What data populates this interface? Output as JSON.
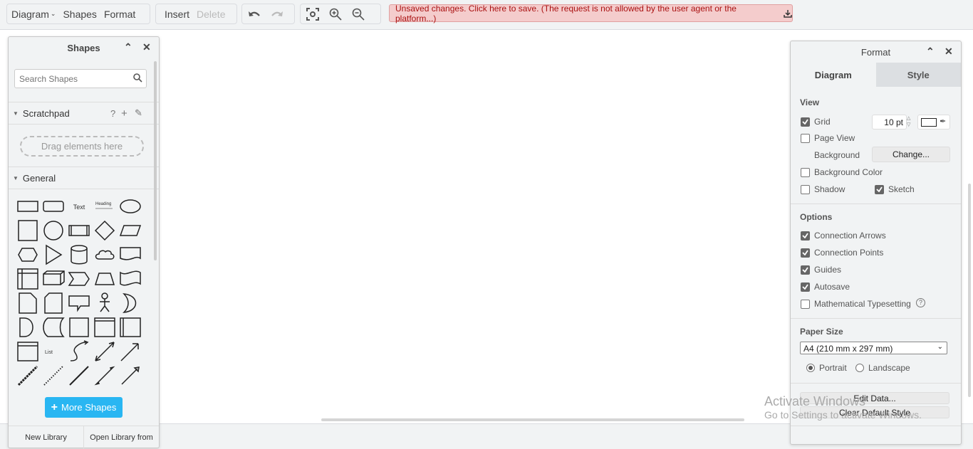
{
  "toolbar": {
    "diagram": "Diagram",
    "shapes": "Shapes",
    "format": "Format",
    "insert": "Insert",
    "delete": "Delete",
    "icons": [
      "undo-icon",
      "redo-icon",
      "fit-icon",
      "zoom-in-icon",
      "zoom-out-icon"
    ],
    "unsaved": "Unsaved changes. Click here to save. (The request is not allowed by the user agent or the platform...)"
  },
  "shapes_panel": {
    "title": "Shapes",
    "search_placeholder": "Search Shapes",
    "scratchpad": "Scratchpad",
    "scratch_help": "?",
    "scratch_add": "+",
    "drag_hint": "Drag elements here",
    "general": "General",
    "text_shape": "Text",
    "heading_shape": "Heading",
    "list_shape": "List",
    "shapes": [
      "rect",
      "rounded",
      "text",
      "heading",
      "ellipse",
      "square",
      "circle",
      "process",
      "diamond",
      "parallelogram",
      "hexagon",
      "triangle",
      "cylinder",
      "cloud",
      "document",
      "internal-storage",
      "cube",
      "step",
      "trapezoid",
      "tape",
      "note",
      "card",
      "callout",
      "actor",
      "or",
      "and",
      "data-storage",
      "container",
      "swimlane",
      "vertical-container",
      "list",
      "list-item",
      "curve",
      "bidirectional-arrow",
      "arrow",
      "dashed-line",
      "dotted-line",
      "line",
      "bidirectional-connector",
      "connector"
    ],
    "more_shapes": "More Shapes",
    "new_library": "New Library",
    "open_library": "Open Library from"
  },
  "format_panel": {
    "title": "Format",
    "tabs": [
      {
        "label": "Diagram",
        "active": true
      },
      {
        "label": "Style",
        "active": false
      }
    ],
    "view": {
      "heading": "View",
      "grid": {
        "label": "Grid",
        "checked": true
      },
      "grid_size": "10 pt",
      "page_view": {
        "label": "Page View",
        "checked": false
      },
      "background_label": "Background",
      "change_button": "Change...",
      "background_color": {
        "label": "Background Color",
        "checked": false
      },
      "shadow": {
        "label": "Shadow",
        "checked": false
      },
      "sketch": {
        "label": "Sketch",
        "checked": true
      }
    },
    "options": {
      "heading": "Options",
      "items": [
        {
          "label": "Connection Arrows",
          "checked": true
        },
        {
          "label": "Connection Points",
          "checked": true
        },
        {
          "label": "Guides",
          "checked": true
        },
        {
          "label": "Autosave",
          "checked": true
        },
        {
          "label": "Mathematical Typesetting",
          "checked": false
        }
      ]
    },
    "paper": {
      "heading": "Paper Size",
      "selected": "A4 (210 mm x 297 mm)",
      "portrait": "Portrait",
      "landscape": "Landscape",
      "orientation": "portrait"
    },
    "edit_data": "Edit Data...",
    "clear_style": "Clear Default Style"
  },
  "watermark": {
    "line1": "Activate Windows",
    "line2": "Go to Settings to activate Windows."
  }
}
